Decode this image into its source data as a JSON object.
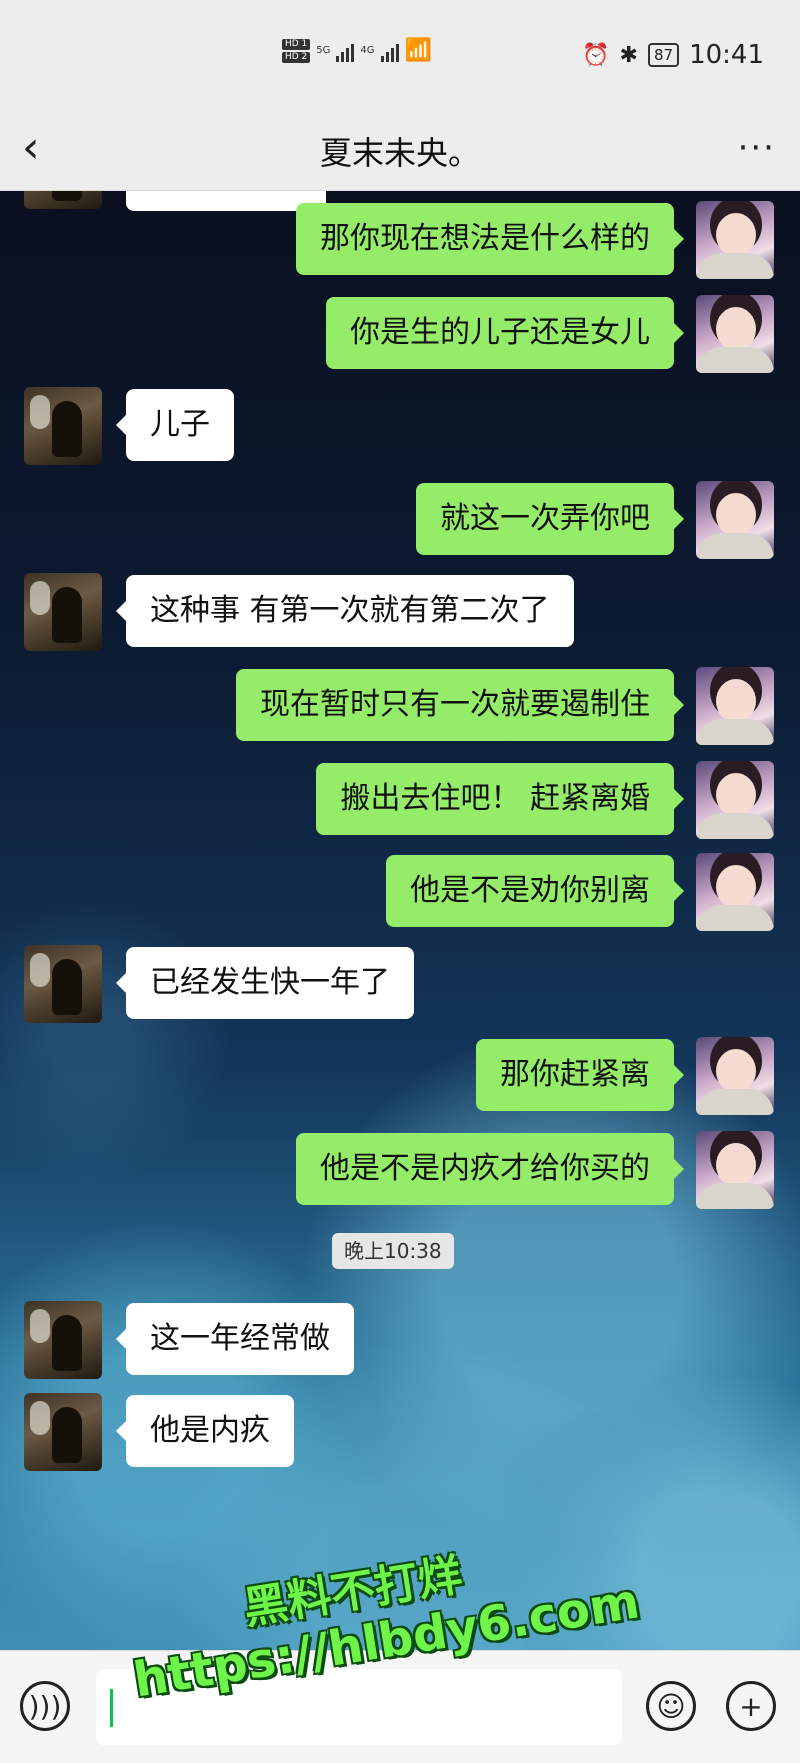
{
  "status_bar": {
    "hd1": "HD 1",
    "hd2": "HD 2",
    "net1": "5G",
    "net2": "4G",
    "battery": "87",
    "time": "10:41"
  },
  "header": {
    "back_icon": "chevron-left-icon",
    "title": "夏末未央。",
    "more_label": "···"
  },
  "messages": [
    {
      "from": "me",
      "text": "那你现在想法是什么样的"
    },
    {
      "from": "me",
      "text": "你是生的儿子还是女儿"
    },
    {
      "from": "them",
      "text": "儿子"
    },
    {
      "from": "me",
      "text": "就这一次弄你吧"
    },
    {
      "from": "them",
      "text": "这种事 有第一次就有第二次了"
    },
    {
      "from": "me",
      "text": "现在暂时只有一次就要遏制住"
    },
    {
      "from": "me",
      "text": "搬出去住吧！ 赶紧离婚"
    },
    {
      "from": "me",
      "text": "他是不是劝你别离"
    },
    {
      "from": "them",
      "text": "已经发生快一年了"
    },
    {
      "from": "me",
      "text": "那你赶紧离"
    },
    {
      "from": "me",
      "text": "他是不是内疚才给你买的"
    },
    {
      "from": "them",
      "text": "这一年经常做"
    },
    {
      "from": "them",
      "text": "他是内疚"
    }
  ],
  "timestamp": "晚上10:38",
  "input_bar": {
    "voice_icon": "voice-icon",
    "emoji_icon": "emoji-icon",
    "plus_icon": "plus-icon"
  },
  "watermark": {
    "line1": "黑料不打烊",
    "line2": "https://hlbdy6.com"
  },
  "colors": {
    "my_bubble": "#95ec69",
    "their_bubble": "#ffffff",
    "bar": "#ededed"
  }
}
